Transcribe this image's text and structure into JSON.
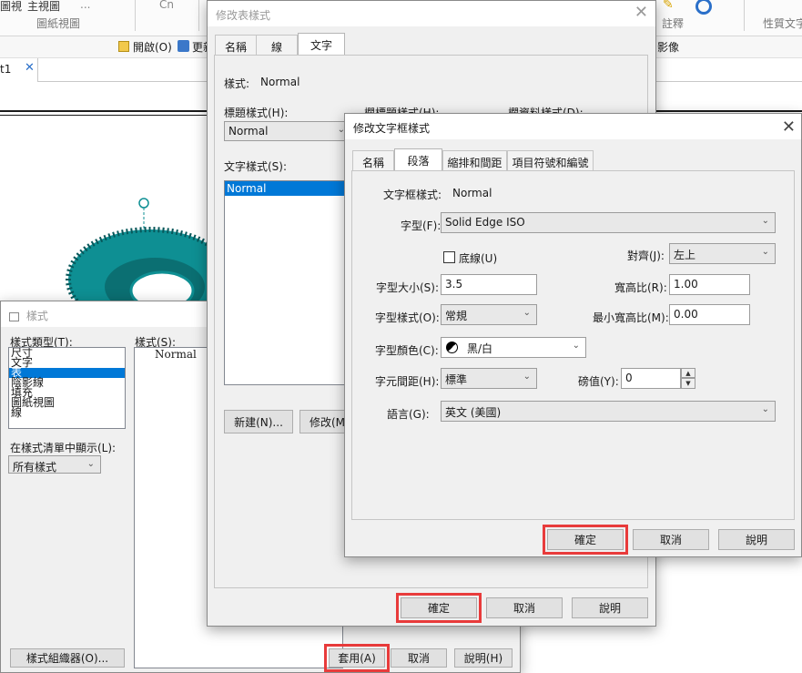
{
  "ribbon": {
    "top_items": [
      "圖視",
      "主視圖",
      "...",
      "Cn"
    ],
    "group_label": "圖紙視圖",
    "annot_label": "註釋",
    "props_label": "性質文字",
    "toolbar_open": "開啟(O)",
    "toolbar_update": "更新",
    "toolbar_mirror": "影像",
    "doc_tab": "t1"
  },
  "style_dialog": {
    "title": "樣式",
    "style_type_label": "樣式類型(T):",
    "style_types": [
      "尺寸",
      "文字",
      "表",
      "陰影線",
      "填充",
      "圖紙視圖",
      "線"
    ],
    "selected_type_index": 2,
    "styles_label": "樣式(S):",
    "styles": [
      "Normal"
    ],
    "show_in_list_label": "在樣式清單中顯示(L):",
    "show_in_list_value": "所有樣式",
    "organizer_button": "樣式組織器(O)...",
    "apply_button": "套用(A)",
    "cancel_button": "取消",
    "help_button": "說明(H)"
  },
  "table_style_dialog": {
    "title": "修改表樣式",
    "tabs": [
      "名稱",
      "線",
      "文字"
    ],
    "active_tab": "文字",
    "style_label": "樣式:",
    "style_value": "Normal",
    "header_style_label": "標題樣式(H):",
    "header_style_value": "Normal",
    "title_style_label": "欄標題樣式(H):",
    "data_style_label": "欄資料樣式(D):",
    "text_style_label": "文字樣式(S):",
    "text_styles": [
      "Normal"
    ],
    "new_button": "新建(N)...",
    "modify_button": "修改(M)...",
    "ok_button": "確定",
    "cancel_button": "取消",
    "help_button": "說明"
  },
  "textbox_dialog": {
    "title": "修改文字框樣式",
    "tabs": [
      "名稱",
      "段落",
      "縮排和間距",
      "項目符號和編號"
    ],
    "active_tab": "段落",
    "textbox_style_label": "文字框樣式:",
    "textbox_style_value": "Normal",
    "font_label": "字型(F):",
    "font_value": "Solid Edge ISO",
    "underline_label": "底線(U)",
    "underline_checked": false,
    "align_label": "對齊(J):",
    "align_value": "左上",
    "font_size_label": "字型大小(S):",
    "font_size_value": "3.5",
    "aspect_label": "寬高比(R):",
    "aspect_value": "1.00",
    "font_style_label": "字型樣式(O):",
    "font_style_value": "常規",
    "min_aspect_label": "最小寬高比(M):",
    "min_aspect_value": "0.00",
    "font_color_label": "字型顏色(C):",
    "font_color_value": "黑/白",
    "char_spacing_label": "字元間距(H):",
    "char_spacing_value": "標準",
    "pounds_label": "磅值(Y):",
    "pounds_value": "0",
    "language_label": "語言(G):",
    "language_value": "英文 (美國)",
    "ok_button": "確定",
    "cancel_button": "取消",
    "help_button": "說明"
  },
  "colors": {
    "highlight_red": "#e83b3b",
    "selection_blue": "#0078d7",
    "gear_teal": "#0e8f93"
  }
}
